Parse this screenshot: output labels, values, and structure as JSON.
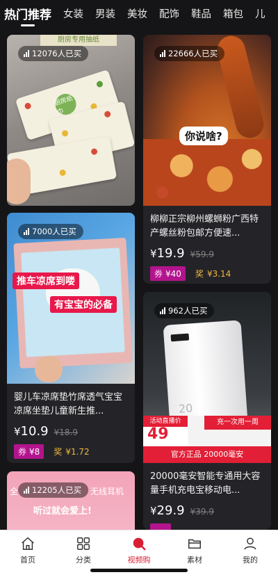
{
  "tabs": [
    {
      "label": "热门推荐",
      "active": true
    },
    {
      "label": "女装"
    },
    {
      "label": "男装"
    },
    {
      "label": "美妆"
    },
    {
      "label": "配饰"
    },
    {
      "label": "鞋品"
    },
    {
      "label": "箱包"
    },
    {
      "label": "儿"
    }
  ],
  "products": [
    {
      "sold": "12076人已买",
      "image_text": [
        "厨房专用抽纸",
        "厨房纸巾"
      ]
    },
    {
      "sold": "22666人已买",
      "image_text": [
        "你说啥?"
      ],
      "title": "柳柳正宗柳州螺蛳粉广西特产螺丝粉包邮方便速...",
      "price_symbol": "¥",
      "price": "19.9",
      "original_price": "59.9",
      "coupon_label": "券",
      "coupon_value": "¥40",
      "reward_label": "奖",
      "reward_value": "¥3.14"
    },
    {
      "sold": "7000人已买",
      "image_text": [
        "推车凉席到喽",
        "有宝宝的必备"
      ],
      "title": "婴儿车凉席垫竹席透气宝宝凉席坐垫儿童新生推...",
      "price_symbol": "¥",
      "price": "10.9",
      "original_price": "18.9",
      "coupon_label": "券",
      "coupon_value": "¥8",
      "reward_label": "奖",
      "reward_value": "¥1.72"
    },
    {
      "sold": "962人已买",
      "image_text": [
        "活动直播价",
        "充一次用一周",
        "49",
        "官方正品 20000毫安",
        "20"
      ],
      "title": "20000毫安智能专通用大容量手机充电宝移动电...",
      "price_symbol": "¥",
      "price": "29.9",
      "original_price": "39.9"
    },
    {
      "sold": "12205人已买",
      "image_text": [
        "全",
        "无线耳机",
        "听过就会爱上!"
      ]
    }
  ],
  "bottom_nav": [
    {
      "label": "首页",
      "icon": "home-icon"
    },
    {
      "label": "分类",
      "icon": "grid-icon"
    },
    {
      "label": "视频购",
      "icon": "video-shop-icon",
      "active": true
    },
    {
      "label": "素材",
      "icon": "folder-icon"
    },
    {
      "label": "我的",
      "icon": "user-icon"
    }
  ],
  "colors": {
    "background": "#151517",
    "card": "#242428",
    "coupon": "#b3148d",
    "reward": "#f0b840",
    "active_nav": "#d81e32"
  }
}
